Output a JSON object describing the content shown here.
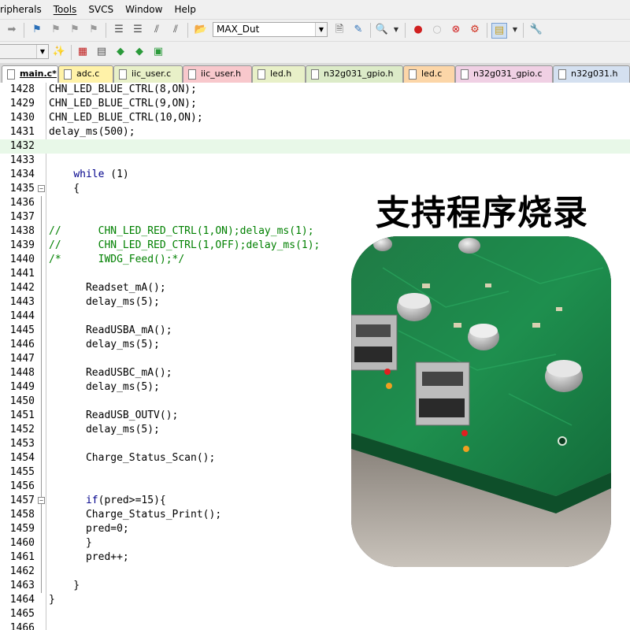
{
  "menu": [
    "ripherals",
    "Tools",
    "SVCS",
    "Window",
    "Help"
  ],
  "toolbar": {
    "target_combo": "MAX_Dut"
  },
  "tabs": [
    {
      "label": "main.c*",
      "color": "#ffffff",
      "active": true
    },
    {
      "label": "adc.c",
      "color": "#fff2a8"
    },
    {
      "label": "iic_user.c",
      "color": "#e8f0c8"
    },
    {
      "label": "iic_user.h",
      "color": "#f8c8cc"
    },
    {
      "label": "led.h",
      "color": "#e8f0c8"
    },
    {
      "label": "n32g031_gpio.h",
      "color": "#dcebc8"
    },
    {
      "label": "led.c",
      "color": "#fcd6a8"
    },
    {
      "label": "n32g031_gpio.c",
      "color": "#f0d0e4"
    },
    {
      "label": "n32g031.h",
      "color": "#d4e0f0"
    }
  ],
  "code_lines": [
    {
      "n": "1428",
      "text": "CHN_LED_BLUE_CTRL(8,ON);"
    },
    {
      "n": "1429",
      "text": "CHN_LED_BLUE_CTRL(9,ON);"
    },
    {
      "n": "1430",
      "text": "CHN_LED_BLUE_CTRL(10,ON);"
    },
    {
      "n": "1431",
      "text": "delay_ms(500);"
    },
    {
      "n": "1432",
      "text": "",
      "highlight": true
    },
    {
      "n": "1433",
      "text": ""
    },
    {
      "n": "1434",
      "text": "    while (1)",
      "kw": "while"
    },
    {
      "n": "1435",
      "text": "    {",
      "fold": "-"
    },
    {
      "n": "1436",
      "text": ""
    },
    {
      "n": "1437",
      "text": ""
    },
    {
      "n": "1438",
      "text": "//      CHN_LED_RED_CTRL(1,ON);delay_ms(1);",
      "comment": true
    },
    {
      "n": "1439",
      "text": "//      CHN_LED_RED_CTRL(1,OFF);delay_ms(1);",
      "comment": true
    },
    {
      "n": "1440",
      "text": "/*      IWDG_Feed();*/",
      "comment": true
    },
    {
      "n": "1441",
      "text": ""
    },
    {
      "n": "1442",
      "text": "      Readset_mA();"
    },
    {
      "n": "1443",
      "text": "      delay_ms(5);"
    },
    {
      "n": "1444",
      "text": ""
    },
    {
      "n": "1445",
      "text": "      ReadUSBA_mA();"
    },
    {
      "n": "1446",
      "text": "      delay_ms(5);"
    },
    {
      "n": "1447",
      "text": ""
    },
    {
      "n": "1448",
      "text": "      ReadUSBC_mA();"
    },
    {
      "n": "1449",
      "text": "      delay_ms(5);"
    },
    {
      "n": "1450",
      "text": ""
    },
    {
      "n": "1451",
      "text": "      ReadUSB_OUTV();"
    },
    {
      "n": "1452",
      "text": "      delay_ms(5);"
    },
    {
      "n": "1453",
      "text": ""
    },
    {
      "n": "1454",
      "text": "      Charge_Status_Scan();"
    },
    {
      "n": "1455",
      "text": ""
    },
    {
      "n": "1456",
      "text": ""
    },
    {
      "n": "1457",
      "text": "      if(pred>=15){",
      "kw": "if",
      "fold": "-"
    },
    {
      "n": "1458",
      "text": "      Charge_Status_Print();"
    },
    {
      "n": "1459",
      "text": "      pred=0;"
    },
    {
      "n": "1460",
      "text": "      }",
      "fold": "end"
    },
    {
      "n": "1461",
      "text": "      pred++;"
    },
    {
      "n": "1462",
      "text": ""
    },
    {
      "n": "1463",
      "text": "    }",
      "fold": "end"
    },
    {
      "n": "1464",
      "text": "}"
    },
    {
      "n": "1465",
      "text": ""
    },
    {
      "n": "1466",
      "text": ""
    }
  ],
  "promo": {
    "title": "支持程序烧录",
    "photo_icon": "pcb-board-photo-icon"
  },
  "colors": {
    "comment": "#008000",
    "keyword": "#00008b",
    "highlight_line": "#e8f8e8",
    "pcb_green": "#1e8f4e"
  }
}
